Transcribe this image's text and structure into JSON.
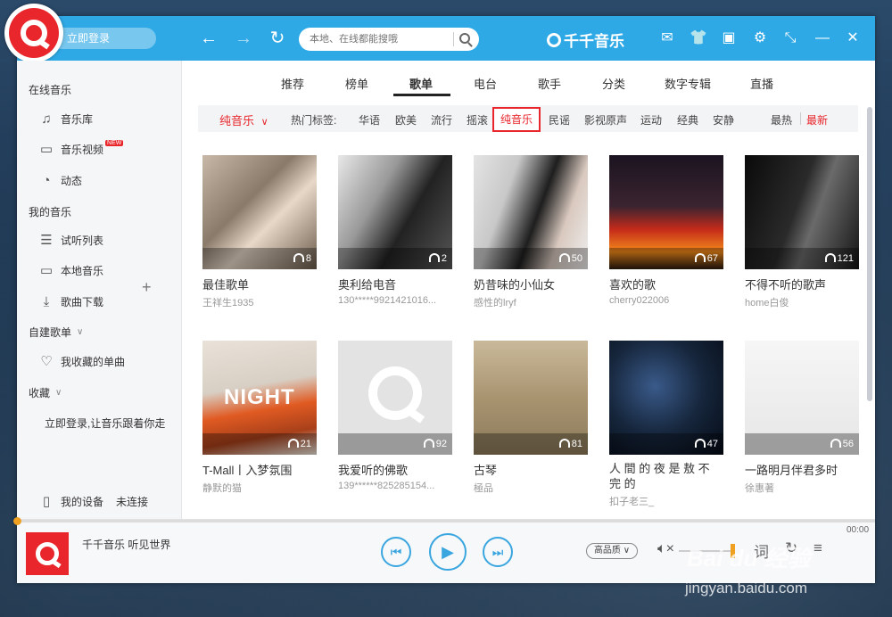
{
  "titlebar": {
    "login_label": "立即登录",
    "search_placeholder": "本地、在线都能搜哦",
    "brand_label": "千千音乐",
    "colors": {
      "accent": "#2fa9e6",
      "brand_red": "#e8262b"
    },
    "icons": [
      "back-icon",
      "forward-icon",
      "refresh-icon",
      "mail-icon",
      "skin-icon",
      "toolbox-icon",
      "settings-icon",
      "minimode-icon",
      "minimize-icon",
      "close-icon"
    ]
  },
  "sidebar": {
    "online_music": "在线音乐",
    "items_online": [
      {
        "label": "音乐库",
        "icon": "music-note-icon"
      },
      {
        "label": "音乐视频",
        "icon": "monitor-icon",
        "badge": "NEW"
      },
      {
        "label": "动态",
        "icon": "dynamic-icon"
      }
    ],
    "my_music": "我的音乐",
    "items_my": [
      {
        "label": "试听列表",
        "icon": "playlist-icon"
      },
      {
        "label": "本地音乐",
        "icon": "computer-icon"
      },
      {
        "label": "歌曲下载",
        "icon": "download-icon"
      }
    ],
    "custom_playlist": "自建歌单",
    "liked": "我收藏的单曲",
    "favorites": "收藏",
    "login_tip": "立即登录,让音乐跟着你走",
    "device_label": "我的设备",
    "device_status": "未连接"
  },
  "main": {
    "tabs": [
      "推荐",
      "榜单",
      "歌单",
      "电台",
      "歌手",
      "分类",
      "数字专辑",
      "直播"
    ],
    "active_tab": "歌单",
    "tagbar": {
      "main_tag": "纯音乐",
      "hot_label": "热门标签:",
      "tags": [
        "华语",
        "欧美",
        "流行",
        "摇滚",
        "纯音乐",
        "民谣",
        "影视原声",
        "运动",
        "经典",
        "安静"
      ],
      "selected": "纯音乐",
      "sort_hot": "最热",
      "sort_new": "最新"
    },
    "playlists": [
      {
        "title": "最佳歌单",
        "author": "王祥生1935",
        "count": "8"
      },
      {
        "title": "奥利给电音",
        "author": "130*****9921421016...",
        "count": "2"
      },
      {
        "title": "奶昔味的小仙女",
        "author": "感性的lryf",
        "count": "50"
      },
      {
        "title": "喜欢的歌",
        "author": "cherry022006",
        "count": "67"
      },
      {
        "title": "不得不听的歌声",
        "author": "home白俊",
        "count": "121"
      },
      {
        "title": "T-Mall丨入梦氛围",
        "author": "静默的猫",
        "count": "21"
      },
      {
        "title": "我爱听的佛歌",
        "author": "139******825285154...",
        "count": "92"
      },
      {
        "title": "古琴",
        "author": "極品",
        "count": "81"
      },
      {
        "title": "人 間 的 夜 是 敖 不 完 的",
        "author": "扣子老三_",
        "count": "47"
      },
      {
        "title": "一路明月伴君多时",
        "author": "徐惠著",
        "count": "56"
      }
    ],
    "cover_texts": {
      "night": "NIGHT"
    }
  },
  "player": {
    "title": "千千音乐 听见世界",
    "quality": "高品质",
    "time": "00:00"
  },
  "watermark": {
    "brand": "Bai du 经验",
    "url": "jingyan.baidu.com"
  }
}
